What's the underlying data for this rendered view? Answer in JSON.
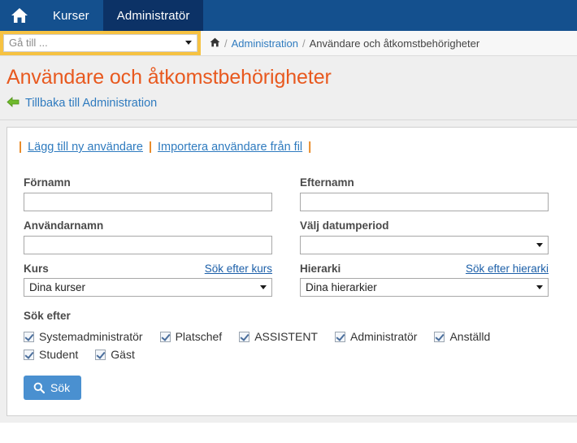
{
  "topnav": {
    "home_icon": "home-icon",
    "tabs": [
      {
        "label": "Kurser",
        "active": false
      },
      {
        "label": "Administratör",
        "active": true
      }
    ]
  },
  "goto": {
    "placeholder": "Gå till ...",
    "value": "Gå till ...",
    "caret_icon": "chevron-down-icon"
  },
  "breadcrumb": {
    "home_icon": "home-icon",
    "sep1": "/",
    "link": "Administration",
    "sep2": "/",
    "current": "Användare och åtkomstbehörigheter"
  },
  "page": {
    "title": "Användare och åtkomstbehörigheter",
    "back_arrow_icon": "arrow-left-icon",
    "back_link": "Tillbaka till Administration"
  },
  "actions": {
    "pipe": "|",
    "add_user": "Lägg till ny användare",
    "import_users": "Importera användare från fil"
  },
  "form": {
    "firstname": {
      "label": "Förnamn",
      "value": ""
    },
    "lastname": {
      "label": "Efternamn",
      "value": ""
    },
    "username": {
      "label": "Användarnamn",
      "value": ""
    },
    "dateperiod": {
      "label": "Välj datumperiod",
      "value": "",
      "caret_icon": "chevron-down-icon"
    },
    "course": {
      "label": "Kurs",
      "side_link": "Sök efter kurs",
      "value": "Dina kurser",
      "caret_icon": "chevron-down-icon"
    },
    "hierarchy": {
      "label": "Hierarki",
      "side_link": "Sök efter hierarki",
      "value": "Dina hierarkier",
      "caret_icon": "chevron-down-icon"
    }
  },
  "search_for": {
    "label": "Sök efter",
    "row1": [
      {
        "label": "Systemadministratör",
        "checked": true
      },
      {
        "label": "Platschef",
        "checked": true
      },
      {
        "label": "ASSISTENT",
        "checked": true
      },
      {
        "label": "Administratör",
        "checked": true
      },
      {
        "label": "Anställd",
        "checked": true
      }
    ],
    "row2": [
      {
        "label": "Student",
        "checked": true
      },
      {
        "label": "Gäst",
        "checked": true
      }
    ]
  },
  "submit": {
    "label": "Sök",
    "icon": "search-icon"
  },
  "colors": {
    "nav_blue": "#14508e",
    "nav_active": "#0c3266",
    "goto_gold": "#f6c242",
    "title_orange": "#e8591f",
    "link_blue": "#2f7bbf",
    "button_blue": "#4a90d0",
    "back_arrow_green": "#6fb92c"
  }
}
